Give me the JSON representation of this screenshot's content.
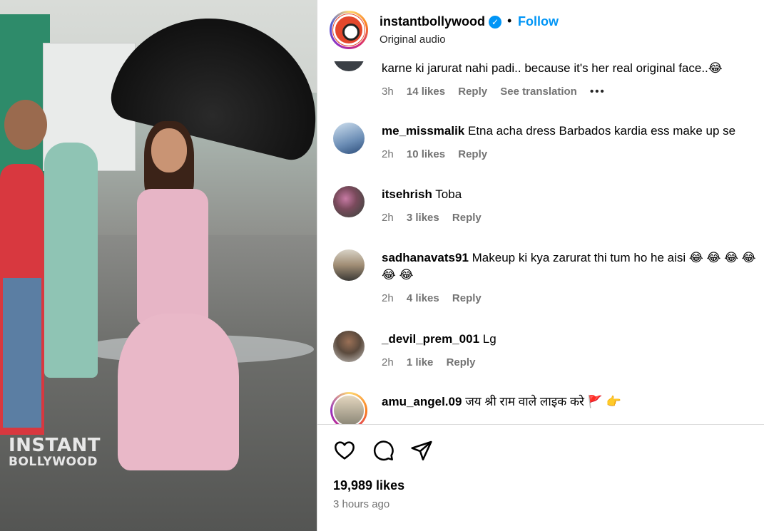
{
  "media": {
    "watermark_line1": "INSTANT",
    "watermark_line2": "BOLLYWOOD"
  },
  "header": {
    "username": "instantbollywood",
    "verified": "✓",
    "separator": "•",
    "follow_label": "Follow",
    "audio": "Original audio"
  },
  "comments": [
    {
      "username": "",
      "text": "karne ki jarurat nahi padi.. because it's her real original face..😂",
      "time": "3h",
      "likes": "14 likes",
      "reply": "Reply",
      "translate": "See translation",
      "more": "•••"
    },
    {
      "username": "me_missmalik",
      "text": "Etna acha dress Barbados kardia ess make up se",
      "time": "2h",
      "likes": "10 likes",
      "reply": "Reply"
    },
    {
      "username": "itsehrish",
      "text": "Toba",
      "time": "2h",
      "likes": "3 likes",
      "reply": "Reply"
    },
    {
      "username": "sadhanavats91",
      "text": "Makeup ki kya zarurat thi tum ho he aisi 😂 😂 😂 😂 😂 😂",
      "time": "2h",
      "likes": "4 likes",
      "reply": "Reply"
    },
    {
      "username": "_devil_prem_001",
      "text": "Lg",
      "time": "2h",
      "likes": "1 like",
      "reply": "Reply"
    },
    {
      "username": "amu_angel.09",
      "text": "जय श्री राम वाले लाइक करे 🚩 👉"
    }
  ],
  "footer": {
    "likes_total": "19,989 likes",
    "posted": "3 hours ago"
  },
  "icons": [
    "heart-icon",
    "comment-icon",
    "share-icon"
  ],
  "colors": {
    "accent": "#0095f6",
    "meta_text": "#737373",
    "divider": "#dbdbdb"
  }
}
